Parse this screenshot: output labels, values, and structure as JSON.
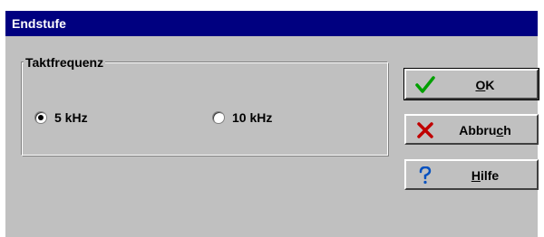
{
  "window": {
    "title": "Endstufe"
  },
  "group": {
    "label": "Taktfrequenz"
  },
  "options": [
    {
      "label": "5 kHz",
      "selected": true
    },
    {
      "label": "10 kHz",
      "selected": false
    }
  ],
  "buttons": {
    "ok": {
      "label_pre": "",
      "mnemonic": "O",
      "label_post": "K",
      "icon": "check-icon"
    },
    "cancel": {
      "label_pre": "Abbru",
      "mnemonic": "c",
      "label_post": "h",
      "icon": "x-icon"
    },
    "help": {
      "label_pre": "",
      "mnemonic": "H",
      "label_post": "ilfe",
      "icon": "question-icon"
    }
  },
  "colors": {
    "title_bar": "#000080",
    "dialog_bg": "#c0c0c0",
    "check": "#00a000",
    "x": "#c00000",
    "question": "#0050c0"
  }
}
